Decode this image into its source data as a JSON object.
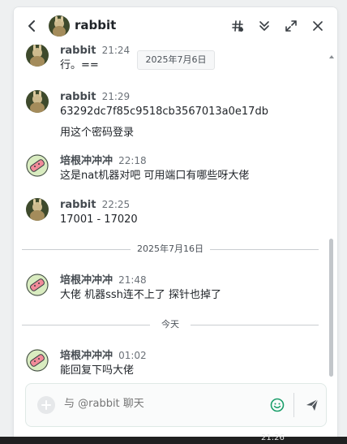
{
  "header": {
    "title": "rabbit",
    "icons": {
      "back": "chevron-left-icon",
      "hashtag": "hashtag-icon",
      "collapse": "double-chevron-down-icon",
      "expand": "expand-icon",
      "close": "close-icon"
    }
  },
  "date_tip": "2025年7月6日",
  "messages": [
    {
      "sender": "rabbit",
      "time": "21:24",
      "lines": [
        "行。=="
      ],
      "avatar": "rabbit-avatar"
    },
    {
      "sender": "rabbit",
      "time": "21:29",
      "lines": [
        "63292dc7f85c9518cb3567013a0e17db",
        "用这个密码登录"
      ],
      "avatar": "rabbit-avatar"
    },
    {
      "sender": "培根冲冲冲",
      "time": "22:18",
      "lines": [
        "这是nat机器对吧 可用端口有哪些呀大佬"
      ],
      "avatar": "bacon-avatar"
    },
    {
      "sender": "rabbit",
      "time": "22:25",
      "lines": [
        "17001 - 17020"
      ],
      "avatar": "rabbit-avatar"
    },
    {
      "sender": "培根冲冲冲",
      "time": "21:48",
      "lines": [
        "大佬 机器ssh连不上了 探针也掉了"
      ],
      "avatar": "bacon-avatar"
    },
    {
      "sender": "培根冲冲冲",
      "time": "01:02",
      "lines": [
        "能回复下吗大佬"
      ],
      "avatar": "bacon-avatar"
    }
  ],
  "dividers": [
    "2025年7月16日",
    "今天"
  ],
  "composer": {
    "placeholder": "与 @rabbit 聊天",
    "icons": {
      "add": "plus-icon",
      "emoji": "smiley-icon",
      "send": "send-icon"
    }
  },
  "taskbar": {
    "clock": "21:26"
  },
  "colors": {
    "accent": "#1a9e6a",
    "rabbit_avatar": "#6b5a3a",
    "bacon_avatar": "#e77a8a"
  }
}
